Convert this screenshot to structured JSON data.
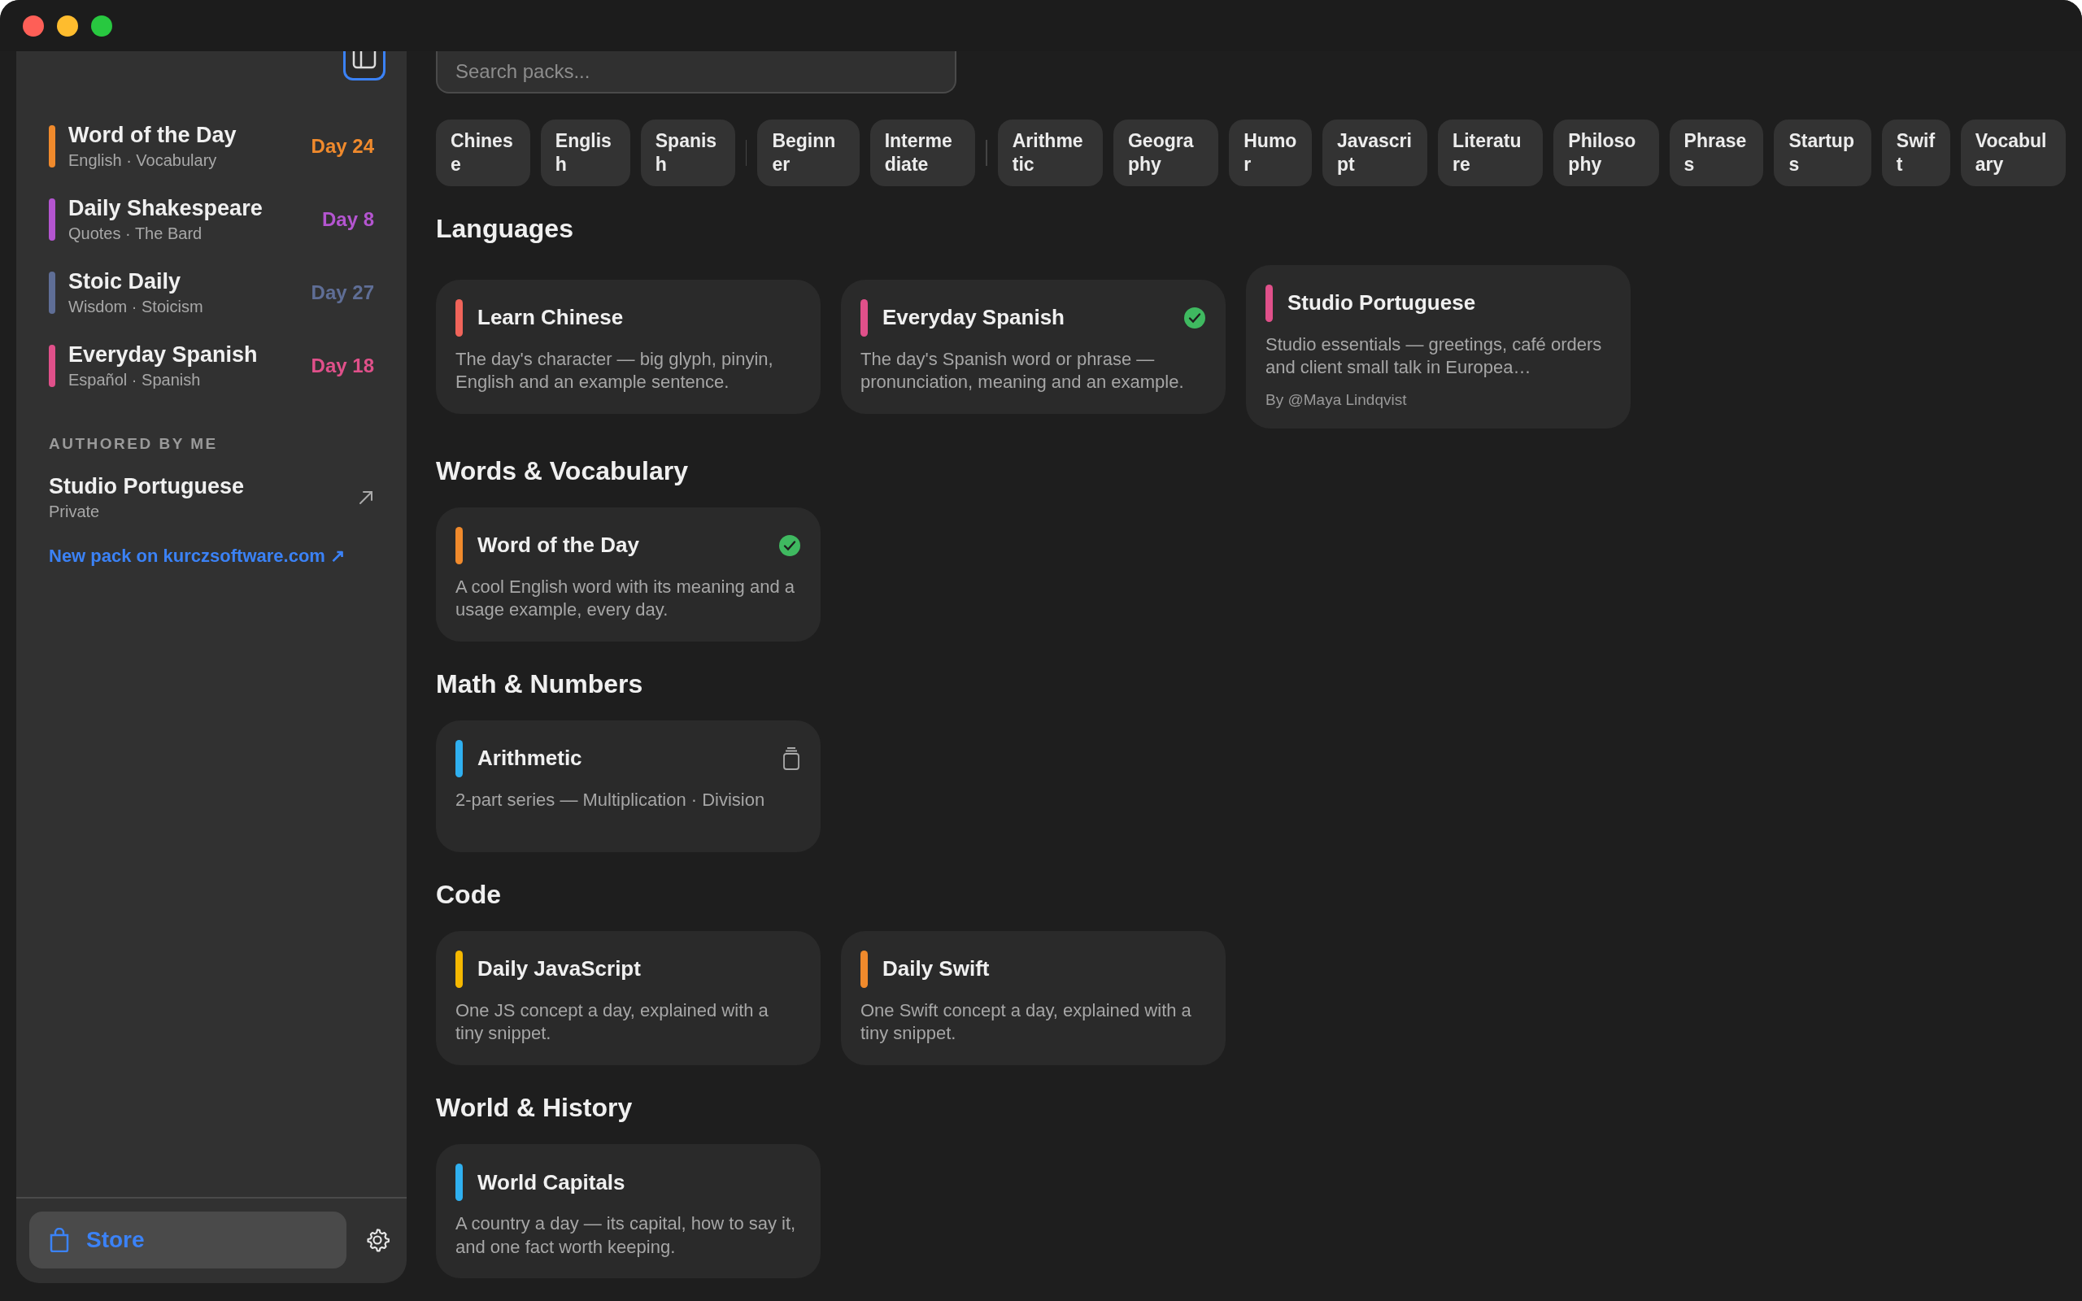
{
  "sidebar": {
    "packs": [
      {
        "title": "Word of the Day",
        "subtitle": "English · Vocabulary",
        "day": "Day 24",
        "color": "#f08a2c"
      },
      {
        "title": "Daily Shakespeare",
        "subtitle": "Quotes · The Bard",
        "day": "Day 8",
        "color": "#b455d0"
      },
      {
        "title": "Stoic Daily",
        "subtitle": "Wisdom · Stoicism",
        "day": "Day 27",
        "color": "#5f6e96"
      },
      {
        "title": "Everyday Spanish",
        "subtitle": "Español · Spanish",
        "day": "Day 18",
        "color": "#e0508a"
      }
    ],
    "authored_heading": "AUTHORED BY ME",
    "authored": [
      {
        "title": "Studio Portuguese",
        "subtitle": "Private"
      }
    ],
    "new_pack_link": "New pack on kurczsoftware.com ↗",
    "store_button": "Store"
  },
  "search": {
    "placeholder": "Search packs..."
  },
  "filter_groups": [
    [
      "Chinese",
      "English",
      "Spanish"
    ],
    [
      "Beginner",
      "Intermediate"
    ],
    [
      "Arithmetic",
      "Geography",
      "Humor",
      "Javascript",
      "Literature",
      "Philosophy",
      "Phrases",
      "Startups",
      "Swift",
      "Vocabulary"
    ]
  ],
  "sections": [
    {
      "title": "Languages",
      "cards": [
        {
          "title": "Learn Chinese",
          "description": "The day's character — big glyph, pinyin, English and an example sentence.",
          "color": "#f0645a",
          "kind": "plain"
        },
        {
          "title": "Everyday Spanish",
          "description": "The day's Spanish word or phrase — pronunciation, meaning and an example.",
          "color": "#e0508a",
          "kind": "added"
        },
        {
          "title": "Studio Portuguese",
          "description": "Studio essentials — greetings, café orders and client small talk in Europea…",
          "author": "By @Maya Lindqvist",
          "color": "#e0508a",
          "kind": "plain"
        }
      ]
    },
    {
      "title": "Words & Vocabulary",
      "cards": [
        {
          "title": "Word of the Day",
          "description": "A cool English word with its meaning and a usage example, every day.",
          "color": "#f08a2c",
          "kind": "added"
        }
      ]
    },
    {
      "title": "Math & Numbers",
      "cards": [
        {
          "title": "Arithmetic",
          "description": "2-part series — Multiplication · Division",
          "color": "#2fb0f0",
          "kind": "series"
        }
      ]
    },
    {
      "title": "Code",
      "cards": [
        {
          "title": "Daily JavaScript",
          "description": "One JS concept a day, explained with a tiny snippet.",
          "color": "#f5b800",
          "kind": "plain"
        },
        {
          "title": "Daily Swift",
          "description": "One Swift concept a day, explained with a tiny snippet.",
          "color": "#f08a2c",
          "kind": "plain"
        }
      ]
    },
    {
      "title": "World & History",
      "cards": [
        {
          "title": "World Capitals",
          "description": "A country a day — its capital, how to say it, and one fact worth keeping.",
          "color": "#2fb0f0",
          "kind": "plain"
        }
      ]
    }
  ]
}
